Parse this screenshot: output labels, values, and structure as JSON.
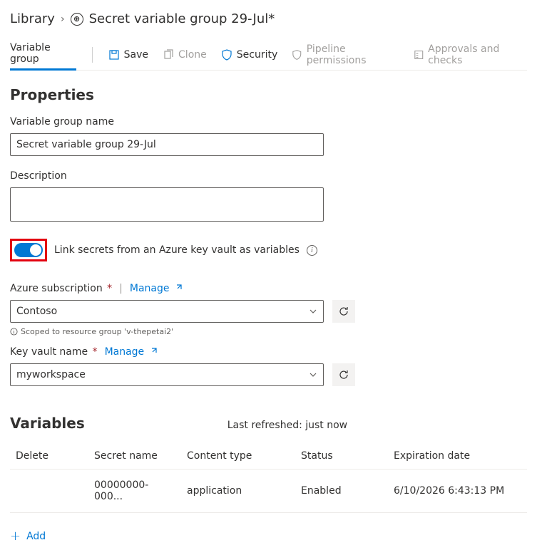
{
  "breadcrumb": {
    "root": "Library",
    "title": "Secret variable group 29-Jul*"
  },
  "toolbar": {
    "tab": "Variable group",
    "save": "Save",
    "clone": "Clone",
    "security": "Security",
    "pipeline": "Pipeline permissions",
    "approvals": "Approvals and checks"
  },
  "properties": {
    "heading": "Properties",
    "name_label": "Variable group name",
    "name_value": "Secret variable group 29-Jul",
    "desc_label": "Description",
    "desc_value": "",
    "toggle_label": "Link secrets from an Azure key vault as variables"
  },
  "azure": {
    "sub_label": "Azure subscription",
    "manage": "Manage",
    "sub_value": "Contoso",
    "scope_hint": "Scoped to resource group 'v-thepetai2'",
    "kv_label": "Key vault name",
    "kv_value": "myworkspace"
  },
  "variables": {
    "heading": "Variables",
    "refreshed": "Last refreshed: just now",
    "cols": {
      "delete": "Delete",
      "secret": "Secret name",
      "content": "Content type",
      "status": "Status",
      "exp": "Expiration date"
    },
    "rows": [
      {
        "secret": "00000000-000...",
        "content": "application",
        "status": "Enabled",
        "exp": "6/10/2026 6:43:13 PM"
      }
    ],
    "add": "Add"
  }
}
